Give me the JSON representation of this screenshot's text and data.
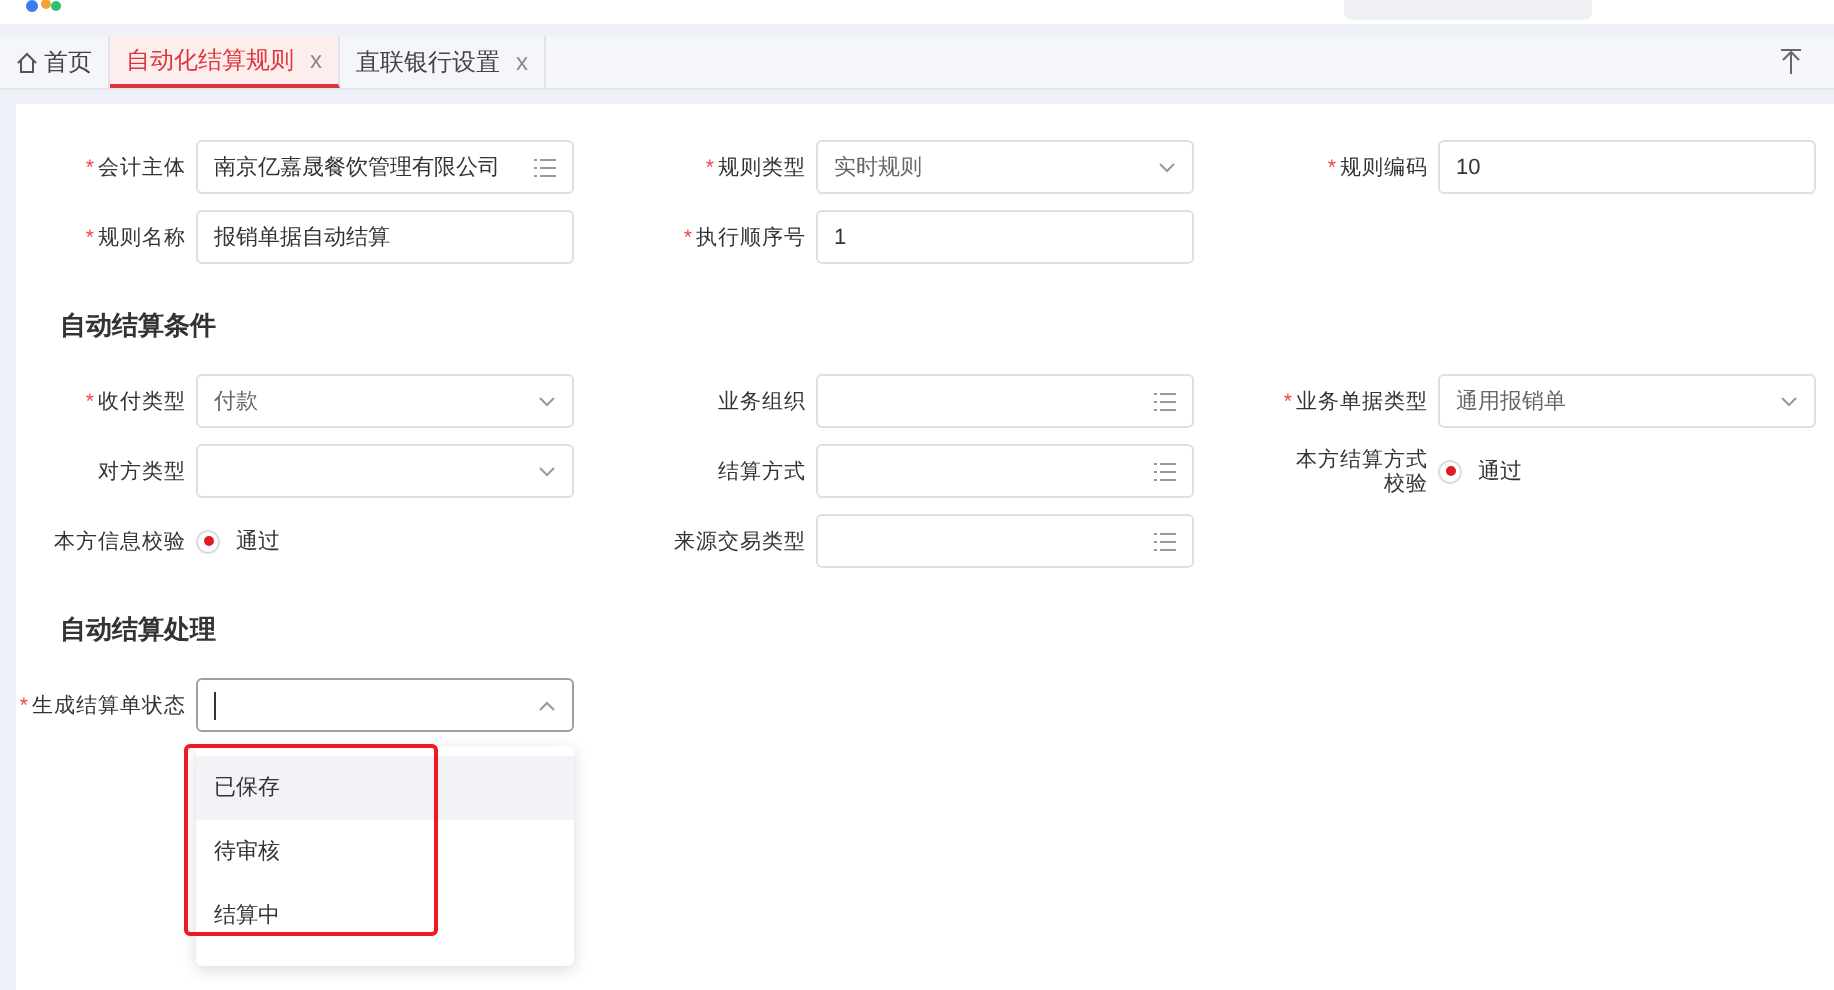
{
  "tabs": [
    {
      "label": "首页",
      "kind": "home",
      "selected": false
    },
    {
      "label": "自动化结算规则",
      "kind": "page",
      "close": "x",
      "selected": true
    },
    {
      "label": "直联银行设置",
      "kind": "page",
      "close": "x",
      "selected": false
    }
  ],
  "sections": [
    {
      "rows": [
        {
          "fields": [
            {
              "label": "会计主体",
              "mark": "*",
              "kind": "lookup",
              "value": "南京亿嘉晟餐饮管理有限公司"
            },
            {
              "label": "规则类型",
              "mark": "*",
              "kind": "select",
              "value": "实时规则"
            },
            {
              "label": "规则编码",
              "mark": "*",
              "kind": "text",
              "value": "10"
            }
          ]
        },
        {
          "fields": [
            {
              "label": "规则名称",
              "mark": "*",
              "kind": "text",
              "value": "报销单据自动结算"
            },
            {
              "label": "执行顺序号",
              "mark": "*",
              "kind": "text",
              "value": "1"
            }
          ]
        }
      ]
    },
    {
      "title": "自动结算条件",
      "rows": [
        {
          "fields": [
            {
              "label": "收付类型",
              "mark": "*",
              "kind": "select",
              "value": "付款"
            },
            {
              "label": "业务组织",
              "kind": "lookup"
            },
            {
              "label": "业务单据类型",
              "mark": "*",
              "kind": "select",
              "value": "通用报销单"
            }
          ]
        },
        {
          "fields": [
            {
              "label": "对方类型",
              "kind": "select"
            },
            {
              "label": "结算方式",
              "kind": "lookup"
            },
            {
              "label": [
                "本方结算方式",
                "校验"
              ],
              "kind": "radio",
              "option": "通过",
              "selected": true
            }
          ]
        },
        {
          "fields": [
            {
              "label": "本方信息校验",
              "kind": "radio",
              "option": "通过",
              "selected": true
            },
            {
              "label": "来源交易类型",
              "kind": "lookup"
            }
          ]
        }
      ]
    },
    {
      "title": "自动结算处理",
      "rows": [
        {
          "fields": [
            {
              "label": "生成结算单状态",
              "mark": "*",
              "kind": "select",
              "open": true,
              "options": [
                {
                  "label": "已保存",
                  "highlighted": true
                },
                {
                  "label": "待审核",
                  "highlighted": false
                },
                {
                  "label": "结算中",
                  "highlighted": false
                }
              ]
            }
          ]
        }
      ]
    }
  ]
}
